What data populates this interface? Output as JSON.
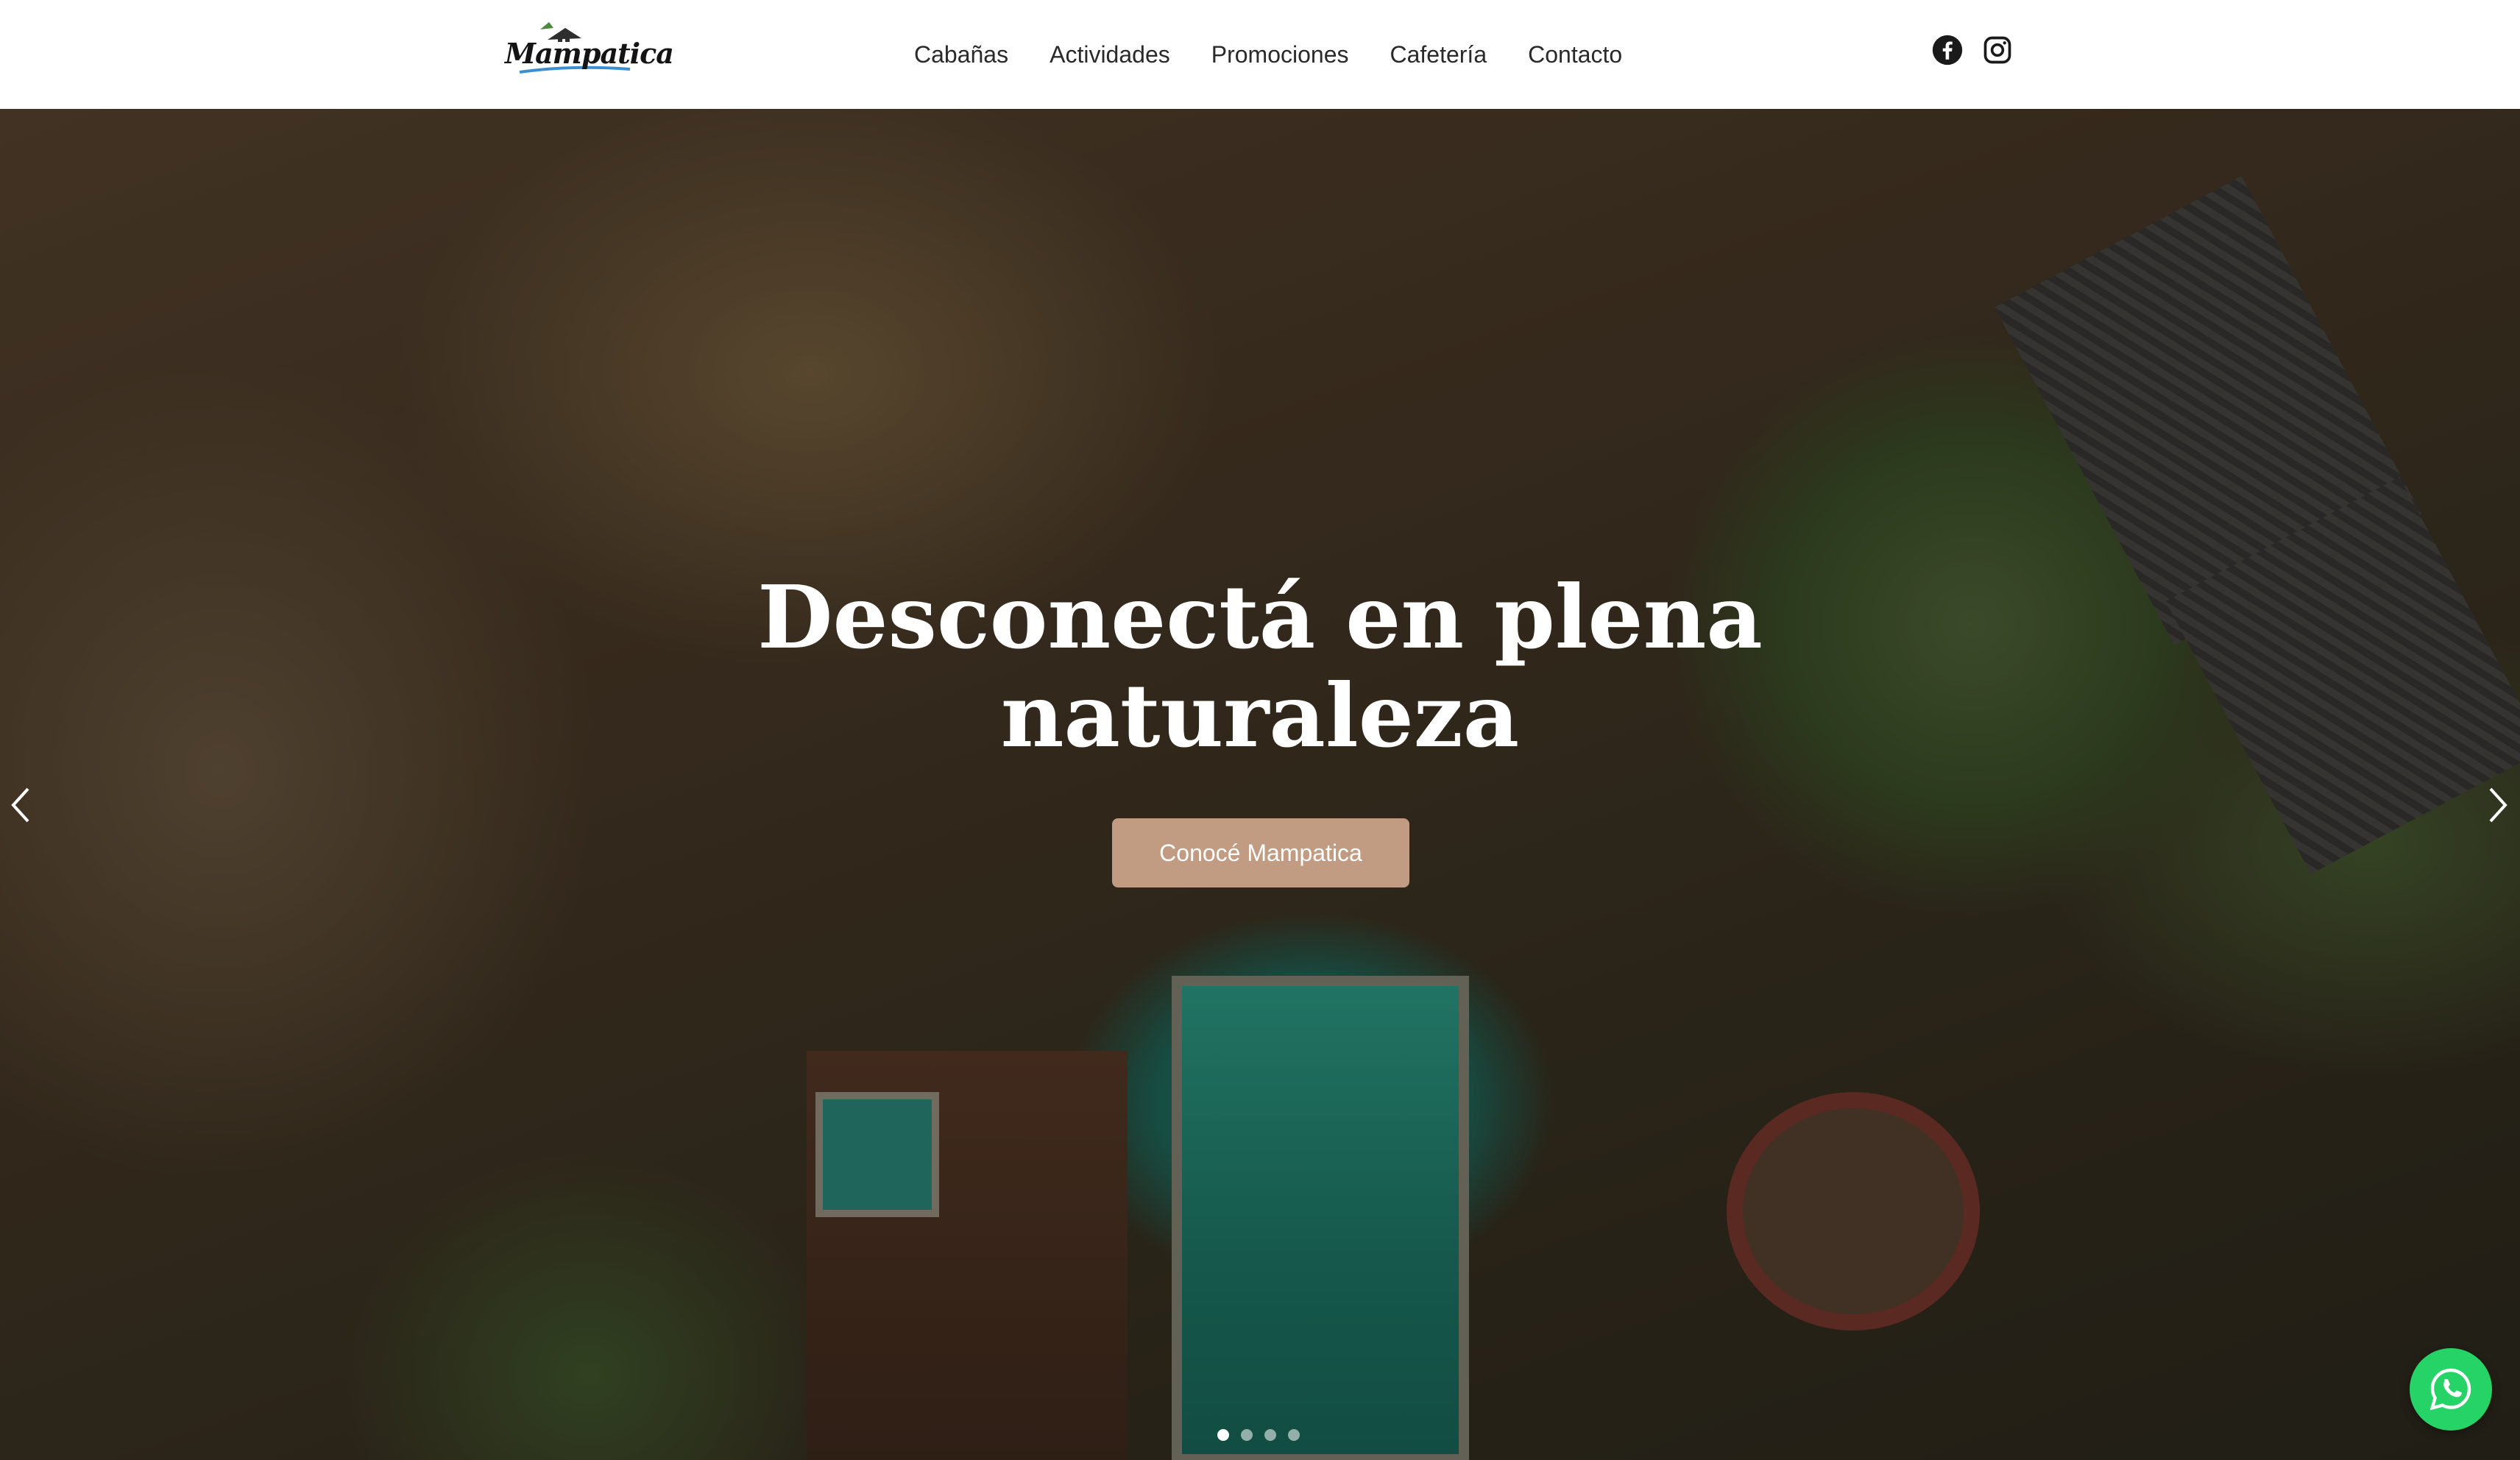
{
  "header": {
    "logo_text": "Mampatica",
    "nav": [
      {
        "label": "Cabañas"
      },
      {
        "label": "Actividades"
      },
      {
        "label": "Promociones"
      },
      {
        "label": "Cafetería"
      },
      {
        "label": "Contacto"
      }
    ],
    "social_icons": [
      "facebook-icon",
      "instagram-icon"
    ]
  },
  "hero": {
    "title": "Desconectá en plena naturaleza",
    "cta_label": "Conocé Mampatica",
    "slides_count": 4,
    "active_slide": 1,
    "cta_color": "#c19b82"
  },
  "floating": {
    "whatsapp_icon": "whatsapp-icon",
    "whatsapp_color": "#25d366"
  }
}
